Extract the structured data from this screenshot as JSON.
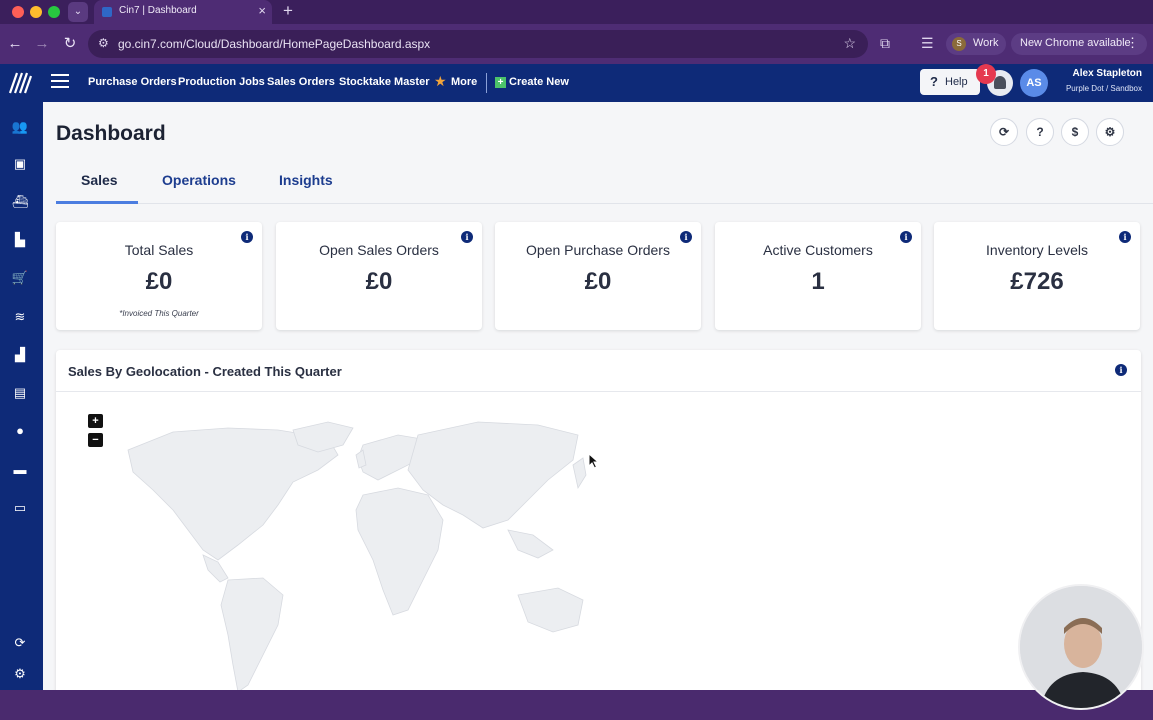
{
  "browser": {
    "tab_title": "Cin7 | Dashboard",
    "url": "go.cin7.com/Cloud/Dashboard/HomePageDashboard.aspx",
    "profile_label": "Work",
    "profile_initial": "S",
    "update_label": "New Chrome available"
  },
  "topnav": {
    "links": [
      "Purchase Orders",
      "Production Jobs",
      "Sales Orders",
      "Stocktake Master",
      "More"
    ],
    "create_label": "Create New",
    "help_label": "Help",
    "notification_count": "1",
    "avatar_initials": "AS",
    "user_name": "Alex Stapleton",
    "user_org": "Purple Dot / Sandbox"
  },
  "sidebar": {
    "icons": [
      "people-icon",
      "box-icon",
      "ship-icon",
      "factory-icon",
      "cart-icon",
      "database-icon",
      "warehouse-icon",
      "bar-chart-icon",
      "piggy-bank-icon",
      "briefcase-icon",
      "store-icon",
      "sync-icon",
      "settings-icon"
    ]
  },
  "page": {
    "title": "Dashboard",
    "tabs": [
      "Sales",
      "Operations",
      "Insights"
    ],
    "active_tab": "Sales"
  },
  "kpis": [
    {
      "title": "Total Sales",
      "value": "£0",
      "note": "*Invoiced This Quarter"
    },
    {
      "title": "Open Sales Orders",
      "value": "£0",
      "note": ""
    },
    {
      "title": "Open Purchase Orders",
      "value": "£0",
      "note": ""
    },
    {
      "title": "Active Customers",
      "value": "1",
      "note": ""
    },
    {
      "title": "Inventory Levels",
      "value": "£726",
      "note": ""
    }
  ],
  "map": {
    "title": "Sales By Geolocation - Created This Quarter",
    "zoom_in": "+",
    "zoom_out": "−"
  },
  "colors": {
    "nav_bg": "#0e2a78",
    "accent": "#4b7de0",
    "badge": "#e53950",
    "chrome_bg": "#4e2c74"
  }
}
